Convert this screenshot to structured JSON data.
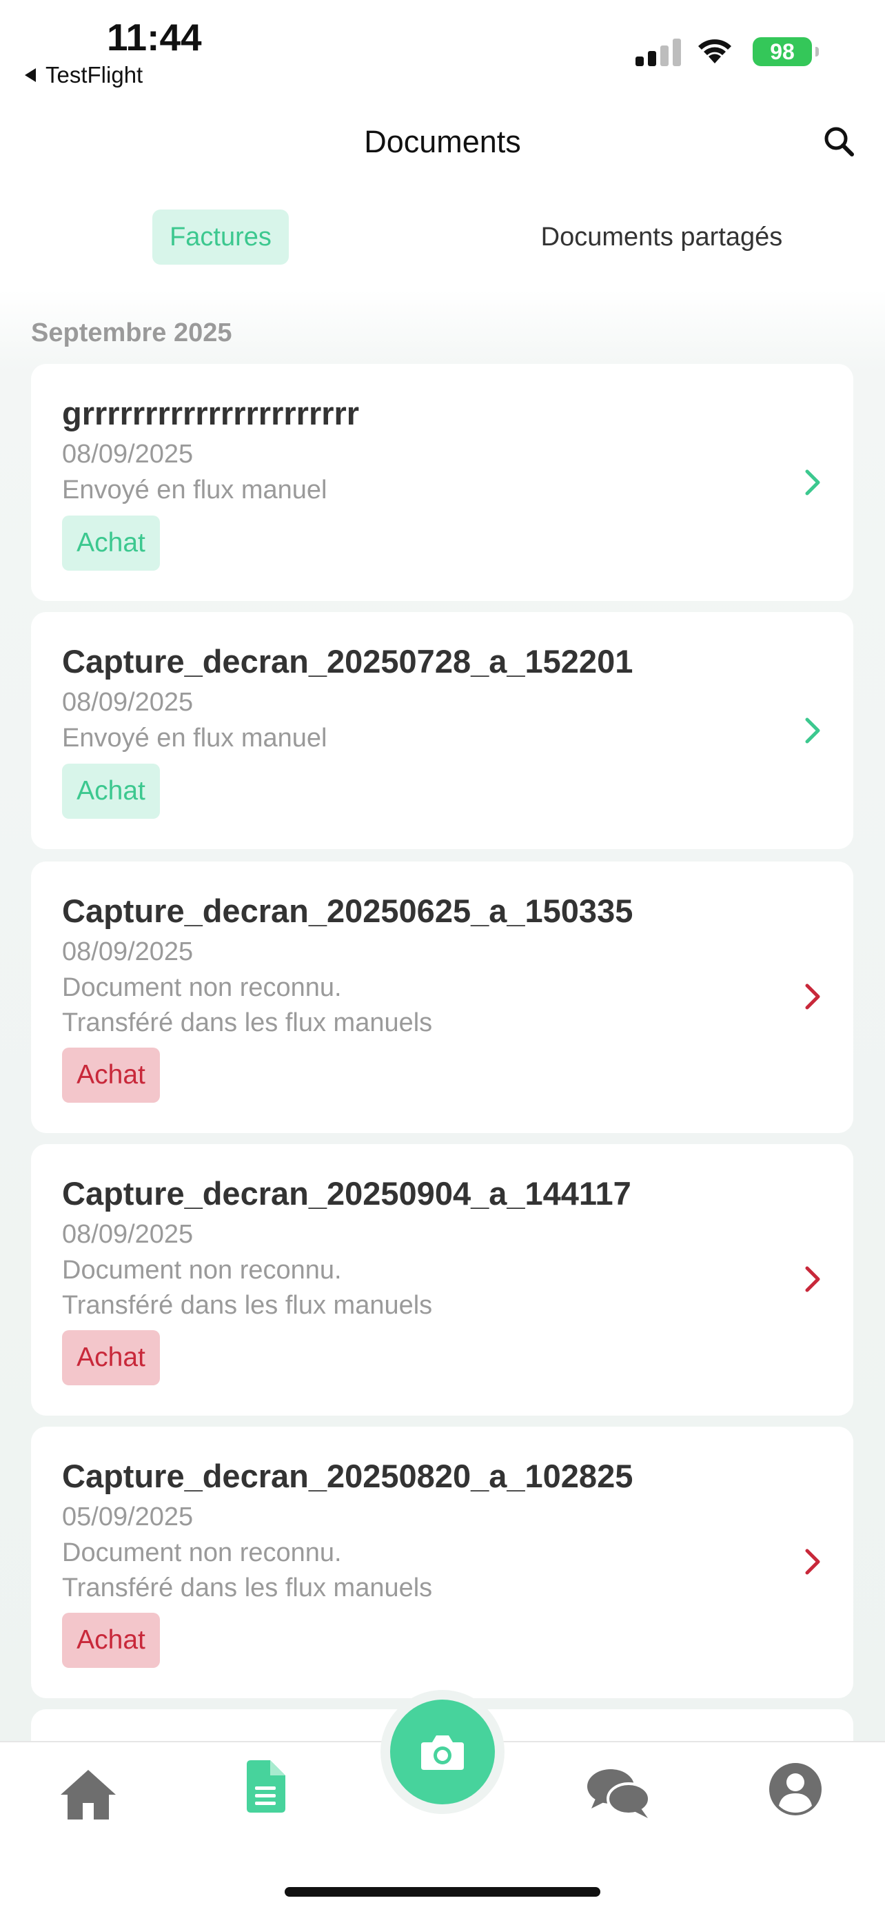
{
  "status_bar": {
    "time": "11:44",
    "back_app": "TestFlight",
    "battery": "98"
  },
  "header": {
    "title": "Documents",
    "search_icon": "search-icon"
  },
  "tabs": [
    {
      "label": "Factures",
      "active": true
    },
    {
      "label": "Documents partagés",
      "active": false
    }
  ],
  "section": {
    "month": "Septembre 2025"
  },
  "documents": [
    {
      "name": "grrrrrrrrrrrrrrrrrrrrrr",
      "date": "08/09/2025",
      "status_lines": [
        "Envoyé en flux manuel"
      ],
      "badge": "Achat",
      "state": "ok"
    },
    {
      "name": "Capture_decran_20250728_a_152201",
      "date": "08/09/2025",
      "status_lines": [
        "Envoyé en flux manuel"
      ],
      "badge": "Achat",
      "state": "ok"
    },
    {
      "name": "Capture_decran_20250625_a_150335",
      "date": "08/09/2025",
      "status_lines": [
        "Document non reconnu.",
        "Transféré dans les flux manuels"
      ],
      "badge": "Achat",
      "state": "error"
    },
    {
      "name": "Capture_decran_20250904_a_144117",
      "date": "08/09/2025",
      "status_lines": [
        "Document non reconnu.",
        "Transféré dans les flux manuels"
      ],
      "badge": "Achat",
      "state": "error"
    },
    {
      "name": "Capture_decran_20250820_a_102825",
      "date": "05/09/2025",
      "status_lines": [
        "Document non reconnu.",
        "Transféré dans les flux manuels"
      ],
      "badge": "Achat",
      "state": "error"
    }
  ],
  "colors": {
    "accent": "#47d39c",
    "accent_light": "#d8f5ea",
    "error": "#c8283a",
    "error_light": "#f3c6cb"
  },
  "tab_bar": {
    "items": [
      {
        "icon": "home-icon",
        "active": false
      },
      {
        "icon": "document-icon",
        "active": true
      },
      {
        "icon": "camera-icon",
        "active": false
      },
      {
        "icon": "chat-icon",
        "active": false
      },
      {
        "icon": "profile-icon",
        "active": false
      }
    ]
  }
}
